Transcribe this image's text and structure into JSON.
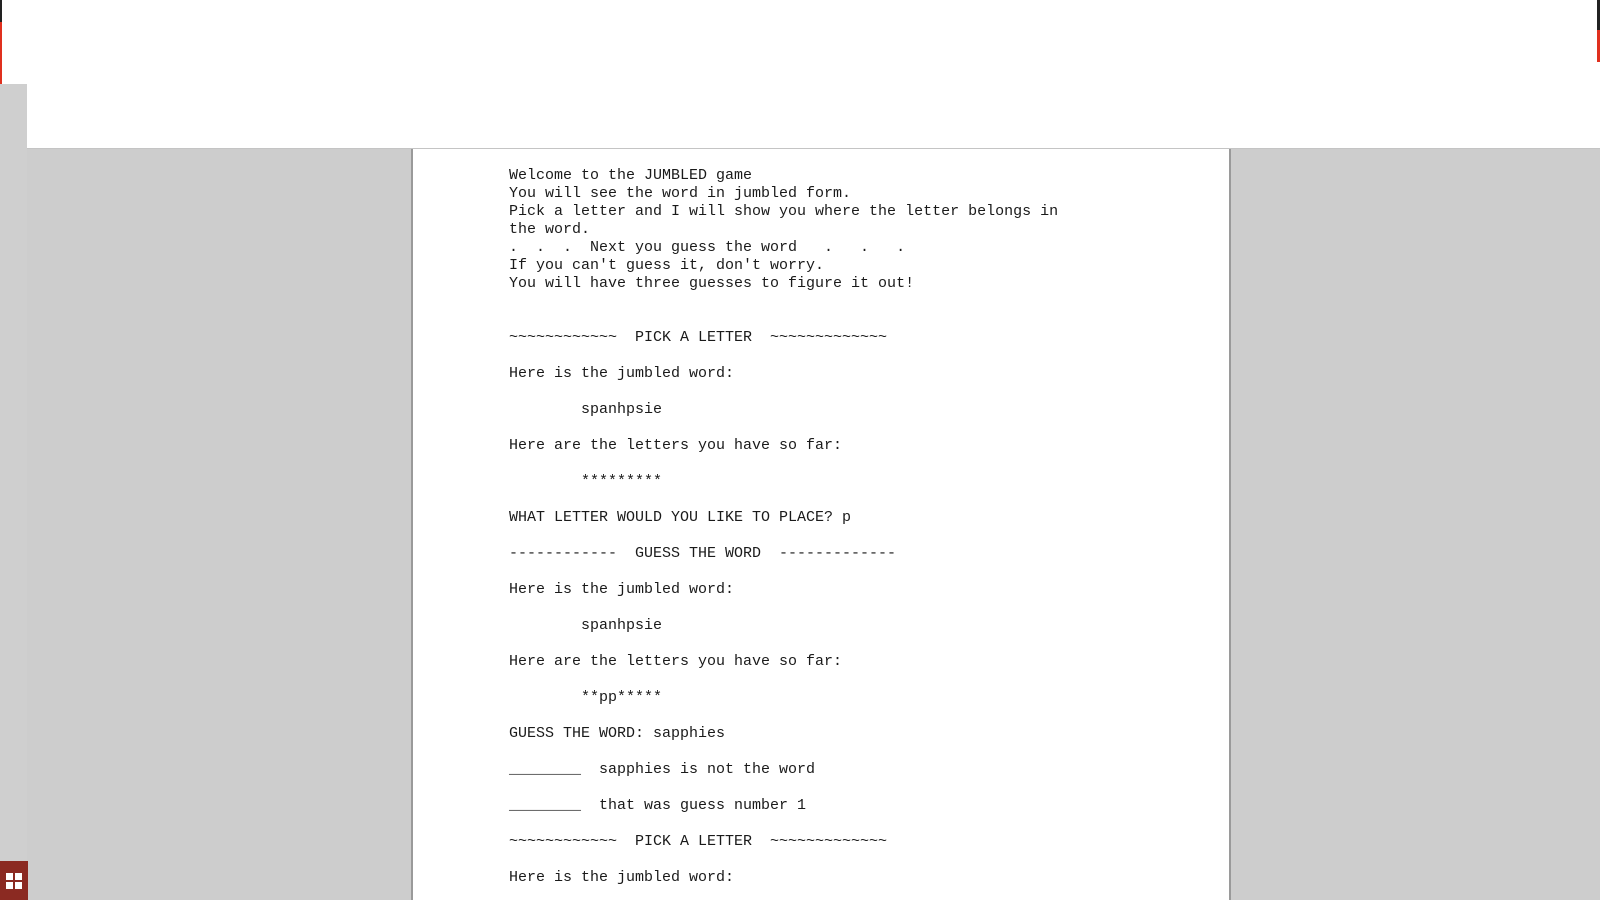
{
  "document": {
    "lines": [
      "Welcome to the JUMBLED game",
      "You will see the word in jumbled form.",
      "Pick a letter and I will show you where the letter belongs in",
      "the word.",
      ".  .  .  Next you guess the word   .   .   .",
      "If you can't guess it, don't worry.",
      "You will have three guesses to figure it out!",
      "",
      "",
      "~~~~~~~~~~~~  PICK A LETTER  ~~~~~~~~~~~~~",
      "",
      "Here is the jumbled word:",
      "",
      "        spanhpsie",
      "",
      "Here are the letters you have so far:",
      "",
      "        *********",
      "",
      "WHAT LETTER WOULD YOU LIKE TO PLACE? p",
      "",
      "------------  GUESS THE WORD  -------------",
      "",
      "Here is the jumbled word:",
      "",
      "        spanhpsie",
      "",
      "Here are the letters you have so far:",
      "",
      "        **pp*****",
      "",
      "GUESS THE WORD: sapphies",
      "",
      "________  sapphies is not the word",
      "",
      "________  that was guess number 1",
      "",
      "~~~~~~~~~~~~  PICK A LETTER  ~~~~~~~~~~~~~",
      "",
      "Here is the jumbled word:"
    ]
  },
  "taskbar": {
    "start_icon": "windows-logo-icon"
  },
  "colors": {
    "viewer_bg": "#cdcdcd",
    "accent": "#e0301e",
    "start_button": "#8b2a22"
  }
}
